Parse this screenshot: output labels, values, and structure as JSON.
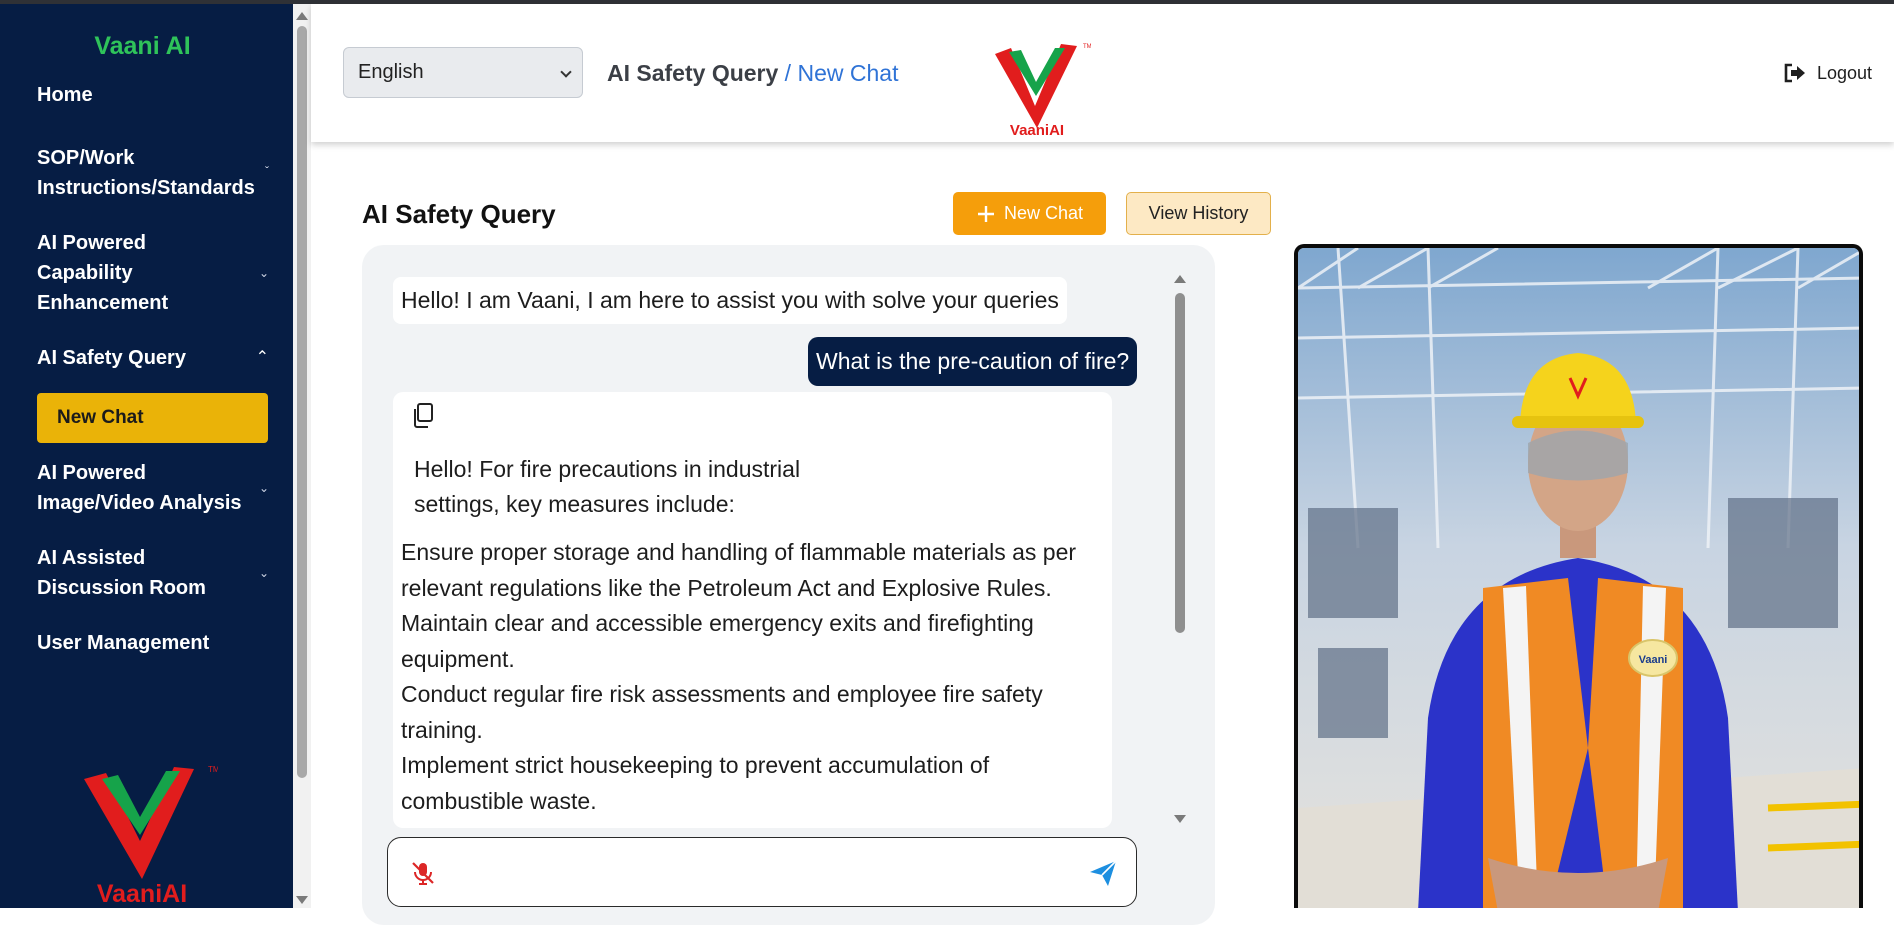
{
  "sidebar": {
    "brand": "Vaani AI",
    "items": [
      {
        "label_lines": [
          "Home"
        ]
      },
      {
        "label_lines": [
          "SOP/Work",
          "Instructions/Standards"
        ]
      },
      {
        "label_lines": [
          "AI Powered",
          "Capability",
          "Enhancement"
        ]
      },
      {
        "label_lines": [
          "AI Safety Query"
        ]
      },
      {
        "label_lines": [
          "AI Powered",
          "Image/Video Analysis"
        ]
      },
      {
        "label_lines": [
          "AI Assisted",
          "Discussion Room"
        ]
      },
      {
        "label_lines": [
          "User Management"
        ]
      }
    ],
    "active_subitem": "New Chat",
    "logo_text": "VaaniAI"
  },
  "header": {
    "language": "English",
    "breadcrumb_parent": "AI Safety Query",
    "breadcrumb_sep": " / ",
    "breadcrumb_current": "New Chat",
    "logo_text": "VaaniAI",
    "logout_label": "Logout"
  },
  "main": {
    "title": "AI Safety Query",
    "new_chat_label": "New Chat",
    "view_history_label": "View History"
  },
  "chat": {
    "greeting": "Hello! I am Vaani, I am here to assist you with solve your queries",
    "user_message": "What is the pre-caution of fire?",
    "answer_intro": "Hello! For fire precautions in industrial settings, key measures include:",
    "answer_points": [
      "Ensure proper storage and handling of flammable materials as per relevant regulations like the Petroleum Act and Explosive Rules.",
      "Maintain clear and accessible emergency exits and firefighting equipment.",
      "Conduct regular fire risk assessments and employee fire safety training.",
      "Implement strict housekeeping to prevent accumulation of combustible waste."
    ],
    "input_placeholder": ""
  },
  "avatar": {
    "badge_text": "Vaani"
  },
  "colors": {
    "sidebar_bg": "#061d44",
    "brand_green": "#2fc35a",
    "active_yellow": "#eab308",
    "new_chat_orange": "#f59e0b",
    "link_blue": "#2f73d6",
    "logo_red": "#e11d1d"
  },
  "icons": [
    "copy-icon",
    "mic-off-icon",
    "send-icon",
    "logout-icon",
    "plus-icon",
    "chevron-down-icon",
    "chevron-up-icon"
  ]
}
